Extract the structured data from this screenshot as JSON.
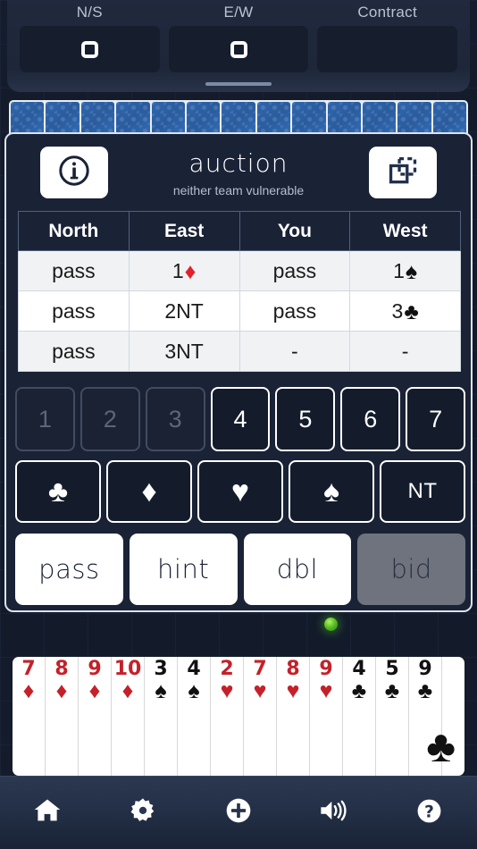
{
  "scoreboard": {
    "columns": [
      {
        "label": "N/S",
        "value": "0",
        "has_value": true
      },
      {
        "label": "E/W",
        "value": "0",
        "has_value": true
      },
      {
        "label": "Contract",
        "value": "",
        "has_value": false
      }
    ]
  },
  "opponent_hand": {
    "card_back_count": 13,
    "card_back_color": "#2f66ad"
  },
  "auction": {
    "title": "auction",
    "subtitle": "neither team vulnerable",
    "info_icon": "info-circle-icon",
    "duplicate_icon": "duplicate-icon",
    "columns": [
      "North",
      "East",
      "You",
      "West"
    ],
    "rows": [
      [
        {
          "text": "pass",
          "suit": "",
          "suit_color": ""
        },
        {
          "text": "1",
          "suit": "♦",
          "suit_color": "#e0232b"
        },
        {
          "text": "pass",
          "suit": "",
          "suit_color": ""
        },
        {
          "text": "1",
          "suit": "♠",
          "suit_color": "#111111"
        }
      ],
      [
        {
          "text": "pass",
          "suit": "",
          "suit_color": ""
        },
        {
          "text": "2NT",
          "suit": "",
          "suit_color": ""
        },
        {
          "text": "pass",
          "suit": "",
          "suit_color": ""
        },
        {
          "text": "3",
          "suit": "♣",
          "suit_color": "#111111"
        }
      ],
      [
        {
          "text": "pass",
          "suit": "",
          "suit_color": ""
        },
        {
          "text": "3NT",
          "suit": "",
          "suit_color": ""
        },
        {
          "text": "-",
          "suit": "",
          "suit_color": ""
        },
        {
          "text": "-",
          "suit": "",
          "suit_color": ""
        }
      ]
    ]
  },
  "bidpad": {
    "levels": [
      {
        "label": "1",
        "enabled": false
      },
      {
        "label": "2",
        "enabled": false
      },
      {
        "label": "3",
        "enabled": false
      },
      {
        "label": "4",
        "enabled": true
      },
      {
        "label": "5",
        "enabled": true
      },
      {
        "label": "6",
        "enabled": true
      },
      {
        "label": "7",
        "enabled": true
      }
    ],
    "suits": [
      {
        "label": "♣",
        "name": "club",
        "is_text": false
      },
      {
        "label": "♦",
        "name": "diamond",
        "is_text": false
      },
      {
        "label": "♥",
        "name": "heart",
        "is_text": false
      },
      {
        "label": "♠",
        "name": "spade",
        "is_text": false
      },
      {
        "label": "NT",
        "name": "no-trump",
        "is_text": true
      }
    ],
    "actions": [
      {
        "label": "pass",
        "enabled": true
      },
      {
        "label": "hint",
        "enabled": true
      },
      {
        "label": "dbl",
        "enabled": true
      },
      {
        "label": "bid",
        "enabled": false
      }
    ]
  },
  "status_indicator": {
    "name": "turn-indicator",
    "color": "#57c123"
  },
  "player_hand": {
    "cards": [
      {
        "rank": "7",
        "suit": "♦",
        "color": "#c4212a"
      },
      {
        "rank": "8",
        "suit": "♦",
        "color": "#c4212a"
      },
      {
        "rank": "9",
        "suit": "♦",
        "color": "#c4212a"
      },
      {
        "rank": "10",
        "suit": "♦",
        "color": "#c4212a"
      },
      {
        "rank": "3",
        "suit": "♠",
        "color": "#111111"
      },
      {
        "rank": "4",
        "suit": "♠",
        "color": "#111111"
      },
      {
        "rank": "2",
        "suit": "♥",
        "color": "#c4212a"
      },
      {
        "rank": "7",
        "suit": "♥",
        "color": "#c4212a"
      },
      {
        "rank": "8",
        "suit": "♥",
        "color": "#c4212a"
      },
      {
        "rank": "9",
        "suit": "♥",
        "color": "#c4212a"
      },
      {
        "rank": "4",
        "suit": "♣",
        "color": "#111111"
      },
      {
        "rank": "5",
        "suit": "♣",
        "color": "#111111"
      },
      {
        "rank": "9",
        "suit": "♣",
        "color": "#111111"
      }
    ],
    "highlight_suit": "♣"
  },
  "nav": {
    "items": [
      {
        "name": "home-icon",
        "label": "home"
      },
      {
        "name": "gear-icon",
        "label": "settings"
      },
      {
        "name": "plus-circle-icon",
        "label": "add"
      },
      {
        "name": "volume-icon",
        "label": "sound"
      },
      {
        "name": "help-icon",
        "label": "help"
      }
    ]
  }
}
